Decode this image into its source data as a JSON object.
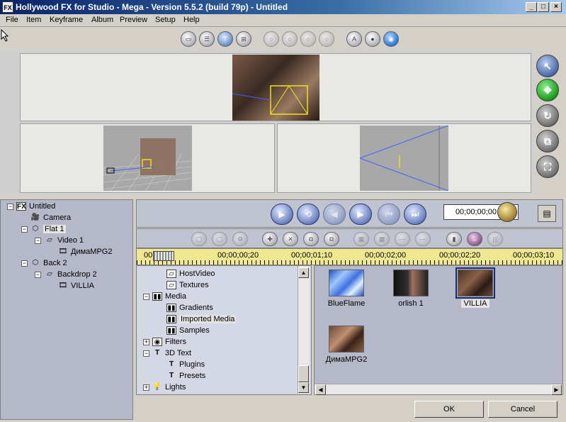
{
  "window": {
    "icon_text": "FX",
    "title": "Hollywood FX for Studio - Mega - Version 5.5.2 (build 79p)  -  Untitled",
    "minimize": "_",
    "maximize": "□",
    "close": "×"
  },
  "menu": [
    "File",
    "Item",
    "Keyframe",
    "Album",
    "Preview",
    "Setup",
    "Help"
  ],
  "scene_tree": {
    "root": "Untitled",
    "items": [
      "Camera",
      "Flat 1",
      "Video 1",
      "ДимаMPG2",
      "Back 2",
      "Backdrop 2",
      "VILLIA"
    ]
  },
  "player": {
    "timecode": "00;00;00;00"
  },
  "timeline": {
    "labels": [
      "00",
      "00;00;00;20",
      "00;00;01;10",
      "00;00;02;00",
      "00;00;02;20",
      "00;00;03;10"
    ]
  },
  "library": {
    "items": [
      "HostVideo",
      "Textures",
      "Media",
      "Gradients",
      "Imported Media",
      "Samples",
      "Filters",
      "3D Text",
      "Plugins",
      "Presets",
      "Lights"
    ]
  },
  "media": {
    "items": [
      "BlueFlame",
      "orlish 1",
      "VILLIA",
      "ДимаMPG2"
    ]
  },
  "buttons": {
    "ok": "OK",
    "cancel": "Cancel"
  },
  "colors": {
    "title_bar": "#0a246a",
    "timeline": "#f0e890",
    "selection": "#1a2a70",
    "wireframe": "#f0e020"
  }
}
